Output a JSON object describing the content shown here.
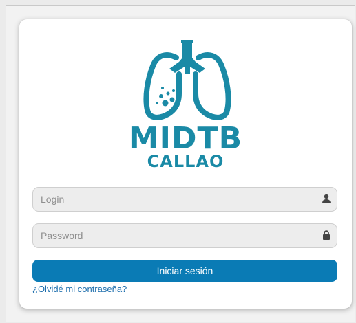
{
  "brand": {
    "name": "MIDTB",
    "subtitle": "CALLAO",
    "color": "#1a8aa6"
  },
  "login": {
    "placeholder": "Login",
    "icon": "user-icon"
  },
  "password": {
    "placeholder": "Password",
    "icon": "lock-icon"
  },
  "submit": {
    "label": "Iniciar sesión",
    "color": "#0a7bb5"
  },
  "forgot": {
    "label": "¿Olvidé mi contraseña?"
  }
}
